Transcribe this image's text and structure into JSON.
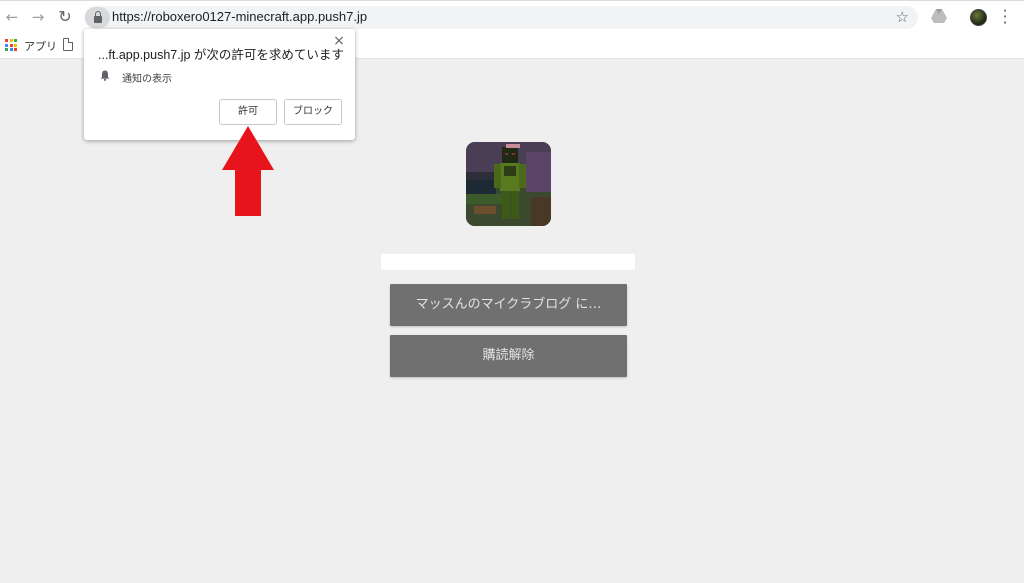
{
  "browser": {
    "url": "https://roboxero0127-minecraft.app.push7.jp",
    "icons": {
      "back": "arrow-left-icon",
      "forward": "arrow-right-icon",
      "reload": "reload-icon",
      "lock": "lock-icon",
      "bookmark_star": "star-icon",
      "extension": "drive-icon",
      "profile": "avatar",
      "menu": "more-vert-icon"
    }
  },
  "bookmarks_bar": {
    "apps_label": "アプリ",
    "apps_colors": [
      "#ea4335",
      "#fbbc05",
      "#34a853",
      "#4285f4",
      "#ea4335",
      "#fbbc05",
      "#34a853",
      "#4285f4",
      "#ea4335"
    ]
  },
  "permission_popup": {
    "title": "...ft.app.push7.jp が次の許可を求めています",
    "permission": "通知の表示",
    "allow_label": "許可",
    "block_label": "ブロック",
    "close_label": "×"
  },
  "annotation": {
    "arrow_color": "#e8141c"
  },
  "site": {
    "subscribe_label": "マッスんのマイクラブログ に…",
    "unsubscribe_label": "購読解除",
    "button_color": "#707070"
  }
}
